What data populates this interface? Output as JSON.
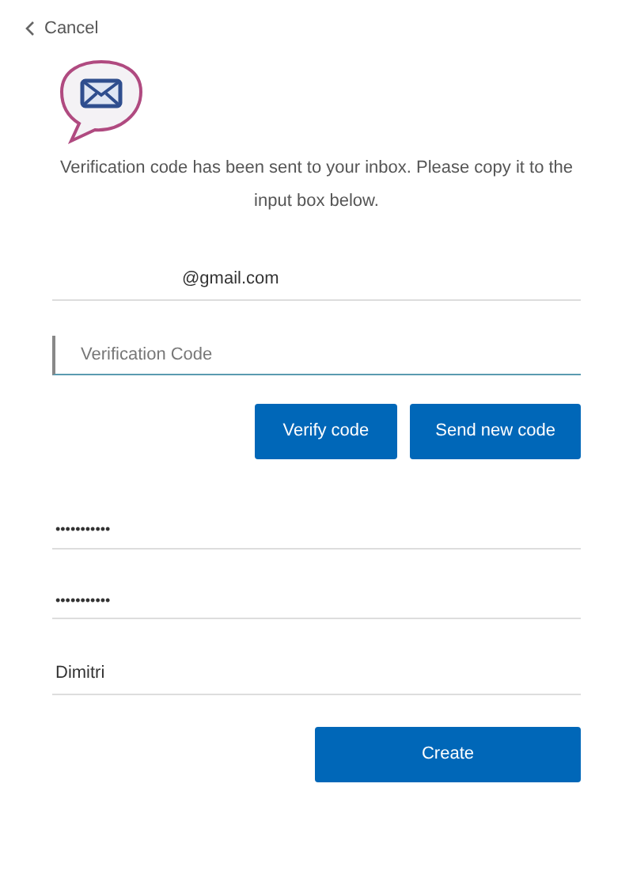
{
  "cancel": {
    "label": "Cancel"
  },
  "message": "Verification code has been sent to your inbox. Please copy it to the input box below.",
  "fields": [
    {
      "kind": "email",
      "value": "@gmail.com",
      "focused": false
    },
    {
      "kind": "code",
      "placeholder": "Verification Code",
      "focused": true
    },
    {
      "kind": "password",
      "value": "•••••••••••",
      "focused": false
    },
    {
      "kind": "password",
      "value": "•••••••••••",
      "focused": false
    },
    {
      "kind": "name",
      "value": "Dimitri",
      "focused": false
    }
  ],
  "code_buttons": [
    "Verify code",
    "Send new code"
  ],
  "create_button": "Create"
}
